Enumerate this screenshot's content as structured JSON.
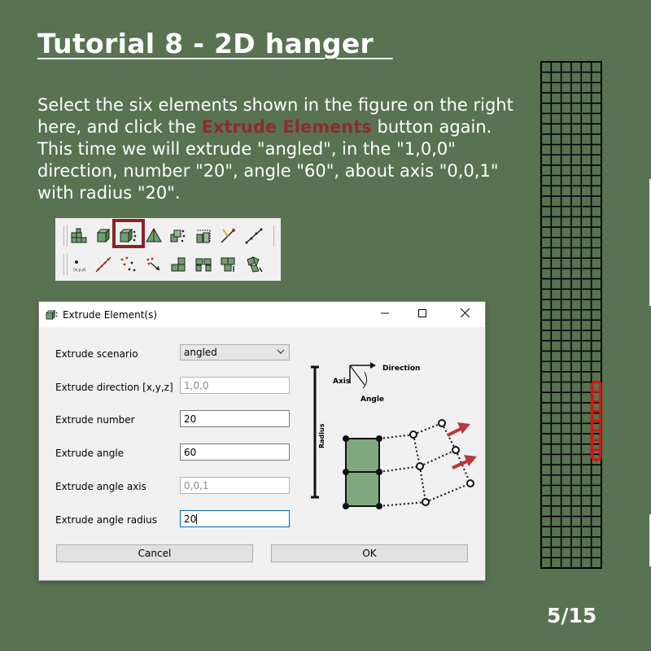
{
  "slide": {
    "title": "Tutorial 8 - 2D hanger  ",
    "intro_before": "Select the six elements shown in the figure on the right here, and click the ",
    "intro_highlight": "Extrude Elements",
    "intro_after": " button again. This time we will extrude \"angled\", in the \"1,0,0\" direction, number \"20\", angle \"60\", about axis \"0,0,1\" with radius \"20\".",
    "page": "5/15",
    "highlight_color": "#8b2424",
    "background_color": "#587252"
  },
  "toolbar": {
    "row1_icons": [
      "grid-mesh-icon",
      "cube-icon",
      "extrude-elements-icon",
      "pyramid-icon",
      "scatter-nodes-icon",
      "extrude-box-icon",
      "transform-icon",
      "line-icon",
      "polyline-icon"
    ],
    "row2_icons": [
      "node-coords-icon",
      "line-nodes-icon",
      "random-nodes-icon",
      "node-arrow-icon",
      "blocks-icon",
      "block-split-icon",
      "block-move-icon",
      "block-rotate-icon"
    ]
  },
  "dialog": {
    "title": "Extrude Element(s)",
    "fields": {
      "scenario": {
        "label": "Extrude scenario",
        "value": "angled"
      },
      "direction": {
        "label": "Extrude direction [x,y,z]",
        "placeholder": "1,0,0"
      },
      "number": {
        "label": "Extrude number",
        "value": "20"
      },
      "angle": {
        "label": "Extrude angle",
        "value": "60"
      },
      "axis": {
        "label": "Extrude angle axis",
        "placeholder": "0,0,1"
      },
      "radius": {
        "label": "Extrude angle radius",
        "value": "20"
      }
    },
    "cancel_label": "Cancel",
    "ok_label": "OK",
    "figure": {
      "direction_label": "Direction",
      "axis_label": "Axis",
      "angle_label": "Angle",
      "radius_label": "Radius"
    }
  },
  "mesh": {
    "columns": 6,
    "rows": 49,
    "selected_rows": [
      "first 9 rows from row 31"
    ],
    "selection_color": "#dd1111"
  }
}
